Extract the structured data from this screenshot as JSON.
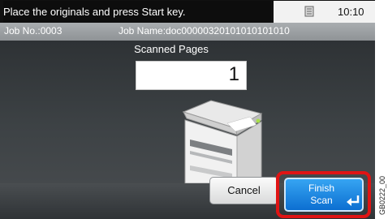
{
  "status": {
    "message": "Place the originals and press Start key.",
    "icon": "job-status-icon",
    "time": "10:10"
  },
  "job": {
    "number": "Job No.:0003",
    "name": "Job Name:doc00000320101010101010"
  },
  "scan": {
    "label": "Scanned Pages",
    "page_count": "1"
  },
  "buttons": {
    "cancel_label": "Cancel",
    "finish_line1": "Finish",
    "finish_line2": "Scan"
  },
  "figure_code": "GB0222_00",
  "colors": {
    "highlight": "#e01414",
    "finish_button": "#1c86e2"
  }
}
